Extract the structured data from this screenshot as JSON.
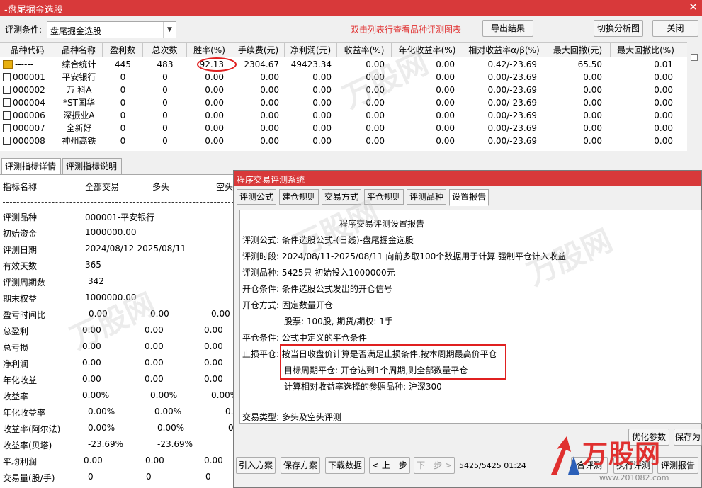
{
  "window": {
    "title": "-盘尾掘金选股",
    "close": "✕"
  },
  "toolbar": {
    "condition_label": "评测条件:",
    "condition_value": "盘尾掘金选股",
    "hint": "双击列表行查看品种评测图表",
    "export_label": "导出结果",
    "switch_label": "切换分析图",
    "close_label": "关闭"
  },
  "table": {
    "headers": [
      "品种代码",
      "品种名称",
      "盈利数",
      "总次数",
      "胜率(%)",
      "手续费(元)",
      "净利润(元)",
      "收益率(%)",
      "年化收益率(%)",
      "相对收益率α/β(%)",
      "最大回撤(元)",
      "最大回撤比(%)"
    ],
    "rows": [
      [
        "------",
        "综合统计",
        "445",
        "483",
        "92.13",
        "2304.67",
        "49423.34",
        "0.00",
        "0.00",
        "0.42/-23.69",
        "65.50",
        "0.01"
      ],
      [
        "000001",
        "平安银行",
        "0",
        "0",
        "0.00",
        "0.00",
        "0.00",
        "0.00",
        "0.00",
        "0.00/-23.69",
        "0.00",
        "0.00"
      ],
      [
        "000002",
        "万 科A",
        "0",
        "0",
        "0.00",
        "0.00",
        "0.00",
        "0.00",
        "0.00",
        "0.00/-23.69",
        "0.00",
        "0.00"
      ],
      [
        "000004",
        "*ST国华",
        "0",
        "0",
        "0.00",
        "0.00",
        "0.00",
        "0.00",
        "0.00",
        "0.00/-23.69",
        "0.00",
        "0.00"
      ],
      [
        "000006",
        "深振业A",
        "0",
        "0",
        "0.00",
        "0.00",
        "0.00",
        "0.00",
        "0.00",
        "0.00/-23.69",
        "0.00",
        "0.00"
      ],
      [
        "000007",
        "全新好",
        "0",
        "0",
        "0.00",
        "0.00",
        "0.00",
        "0.00",
        "0.00",
        "0.00/-23.69",
        "0.00",
        "0.00"
      ],
      [
        "000008",
        "神州高铁",
        "0",
        "0",
        "0.00",
        "0.00",
        "0.00",
        "0.00",
        "0.00",
        "0.00/-23.69",
        "0.00",
        "0.00"
      ]
    ]
  },
  "left_tabs": [
    "评测指标详情",
    "评测指标说明"
  ],
  "detail": {
    "headers": [
      "指标名称",
      "全部交易",
      "多头",
      "空头"
    ],
    "rows": [
      {
        "name": "评测品种",
        "all": "000001-平安银行",
        "long": "",
        "short": ""
      },
      {
        "name": "初始资金",
        "all": "1000000.00",
        "long": "",
        "short": ""
      },
      {
        "name": "评测日期",
        "all": "2024/08/12-2025/08/11",
        "long": "",
        "short": ""
      },
      {
        "name": "有效天数",
        "all": "365",
        "long": "",
        "short": ""
      },
      {
        "name": "评测周期数",
        "all": "342",
        "long": "",
        "short": ""
      },
      {
        "name": "期末权益",
        "all": "1000000.00",
        "long": "",
        "short": ""
      },
      {
        "name": "盈亏时间比",
        "all": "0.00",
        "long": "0.00",
        "short": "0.00"
      },
      {
        "name": "总盈利",
        "all": "0.00",
        "long": "0.00",
        "short": "0.00"
      },
      {
        "name": "总亏损",
        "all": "0.00",
        "long": "0.00",
        "short": "0.00"
      },
      {
        "name": "净利润",
        "all": "0.00",
        "long": "0.00",
        "short": "0.00"
      },
      {
        "name": "年化收益",
        "all": "0.00",
        "long": "0.00",
        "short": "0.00"
      },
      {
        "name": "收益率",
        "all": "0.00%",
        "long": "0.00%",
        "short": "0.00%"
      },
      {
        "name": "年化收益率",
        "all": "0.00%",
        "long": "0.00%",
        "short": "0."
      },
      {
        "name": "收益率(阿尔法)",
        "all": "0.00%",
        "long": "0.00%",
        "short": "0."
      },
      {
        "name": "收益率(贝塔)",
        "all": "-23.69%",
        "long": "-23.69%",
        "short": ""
      },
      {
        "name": "平均利润",
        "all": "0.00",
        "long": "0.00",
        "short": "0.00"
      },
      {
        "name": "交易量(股/手)",
        "all": "0",
        "long": "0",
        "short": "0"
      }
    ]
  },
  "dialog": {
    "title": "程序交易评测系统",
    "tabs": [
      "评测公式",
      "建仓规则",
      "交易方式",
      "平仓规则",
      "评测品种",
      "设置报告"
    ],
    "report": {
      "heading": "程序交易评测设置报告",
      "lines": [
        "评测公式:  条件选股公式-(日线)-盘尾掘金选股",
        "评测时段:  2024/08/11-2025/08/11 向前多取100个数据用于计算 强制平仓计入收益",
        "评测品种:  5425只 初始投入1000000元",
        "开仓条件:  条件选股公式发出的开仓信号",
        "开仓方式:  固定数量开仓",
        "股票: 100股, 期货/期权: 1手",
        "平仓条件:  公式中定义的平仓条件",
        "止损平仓:  按当日收盘价计算是否满足止损条件,按本周期最高价平仓",
        "目标周期平仓:  开仓达到1个周期,则全部数量平仓",
        "计算相对收益率选择的参照品种:  沪深300",
        "交易类型:  多头及空头评测"
      ]
    },
    "buttons": {
      "optimize": "优化参数",
      "save_as": "保存为",
      "import_plan": "引入方案",
      "save_plan": "保存方案",
      "download": "下载数据",
      "prev": "< 上一步",
      "next": "下一步 >",
      "progress": "5425/5425  01:24",
      "combined": "合评测",
      "execute": "执行评测",
      "report": "评测报告"
    }
  },
  "watermark": {
    "text": "万股网",
    "logo": "万股网",
    "url": "www.201082.com"
  },
  "colors": {
    "title_bar": "#d8393a",
    "hint": "#e03030",
    "annotation": "#e02020"
  }
}
